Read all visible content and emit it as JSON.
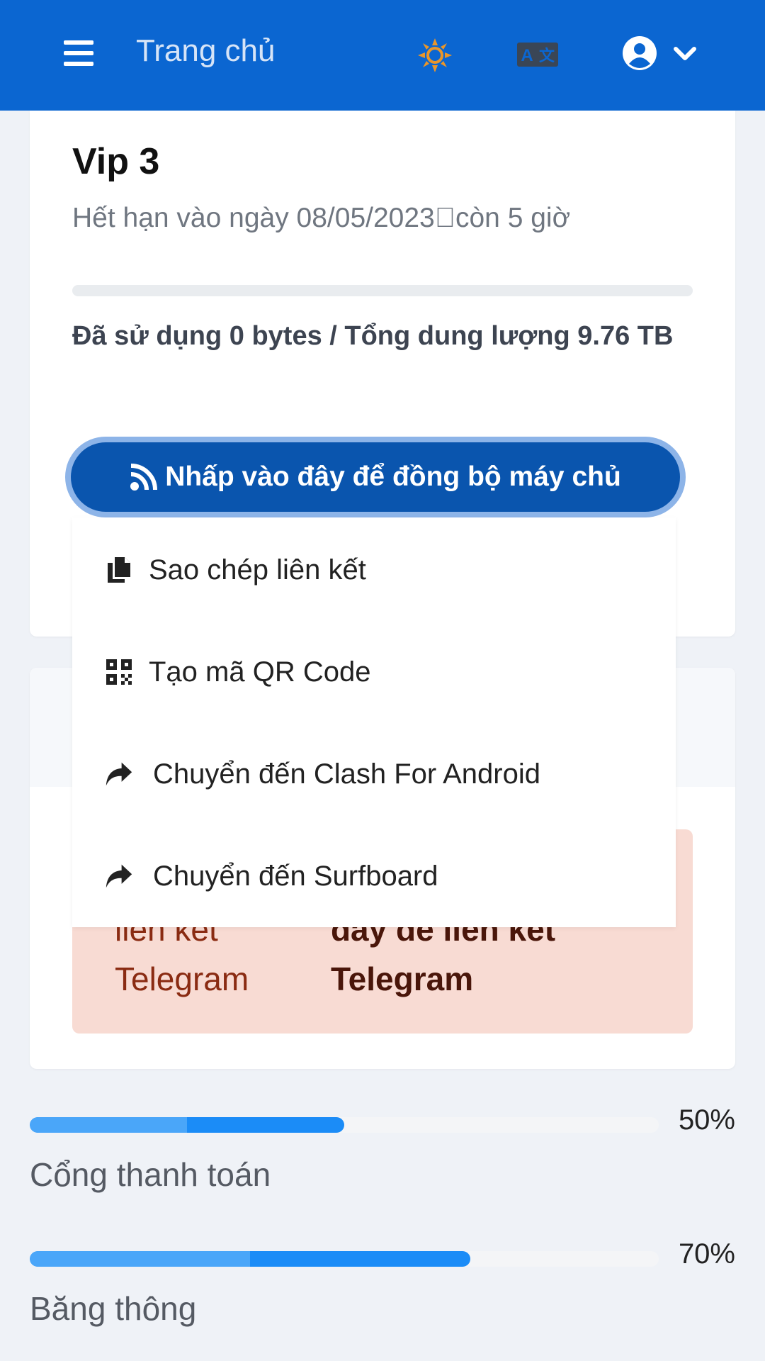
{
  "header": {
    "title": "Trang chủ",
    "menu_icon": "hamburger-menu-icon",
    "theme_icon": "sun-icon",
    "language_icon": "translate-icon",
    "user_icon": "user-circle-icon",
    "chevron_icon": "chevron-down-icon",
    "background": "#0b66d1"
  },
  "subscription": {
    "plan_name": "Vip 3",
    "expiry": "Hết hạn vào ngày 08/05/2023􏿾còn 5 giờ",
    "usage_fraction": 0,
    "usage_text": "Đã sử dụng 0 bytes / Tổng dung lượng 9.76 TB",
    "sync_button": "Nhấp vào đây để đồng bộ máy chủ",
    "sync_icon": "rss-icon"
  },
  "sync_menu": [
    {
      "label": "Sao chép liên kết",
      "icon": "copy-icon"
    },
    {
      "label": "Tạo mã QR Code",
      "icon": "qrcode-icon"
    },
    {
      "label": "Chuyển đến Clash For Android",
      "icon": "share-arrow-icon"
    },
    {
      "label": "Chuyển đến Surfboard",
      "icon": "share-arrow-icon"
    }
  ],
  "alert": {
    "left_line1": "liên kết",
    "left_line2": "Telegram",
    "right_line1": "đây để liên kết",
    "right_line2": "Telegram",
    "background": "#f8dbd3"
  },
  "stats": [
    {
      "label": "Cổng thanh toán",
      "percent_text": "50%",
      "value": 0.5
    },
    {
      "label": "Băng thông",
      "percent_text": "70%",
      "value": 0.7
    }
  ]
}
